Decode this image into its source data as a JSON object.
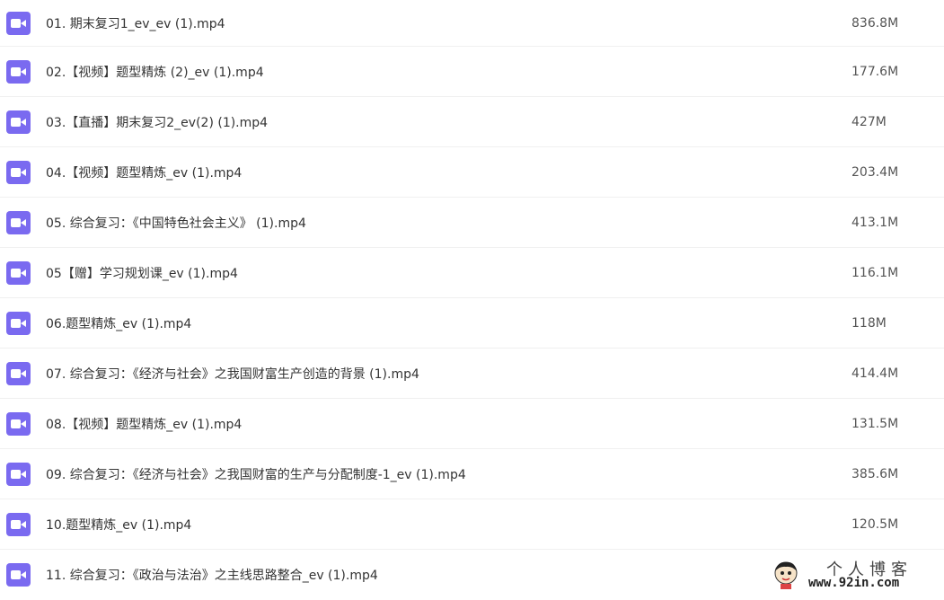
{
  "files": [
    {
      "name": "01. 期末复习1_ev_ev (1).mp4",
      "size": "836.8M",
      "icon": "video-file-icon"
    },
    {
      "name": "02.【视频】题型精炼 (2)_ev (1).mp4",
      "size": "177.6M",
      "icon": "video-file-icon"
    },
    {
      "name": "03.【直播】期末复习2_ev(2) (1).mp4",
      "size": "427M",
      "icon": "video-file-icon"
    },
    {
      "name": "04.【视频】题型精炼_ev (1).mp4",
      "size": "203.4M",
      "icon": "video-file-icon"
    },
    {
      "name": "05. 综合复习：《中国特色社会主义》 (1).mp4",
      "size": "413.1M",
      "icon": "video-file-icon"
    },
    {
      "name": "05【赠】学习规划课_ev (1).mp4",
      "size": "116.1M",
      "icon": "video-file-icon"
    },
    {
      "name": "06.题型精炼_ev (1).mp4",
      "size": "118M",
      "icon": "video-file-icon"
    },
    {
      "name": "07. 综合复习：《经济与社会》之我国财富生产创造的背景 (1).mp4",
      "size": "414.4M",
      "icon": "video-file-icon"
    },
    {
      "name": "08.【视频】题型精炼_ev (1).mp4",
      "size": "131.5M",
      "icon": "video-file-icon"
    },
    {
      "name": "09. 综合复习：《经济与社会》之我国财富的生产与分配制度-1_ev (1).mp4",
      "size": "385.6M",
      "icon": "video-file-icon"
    },
    {
      "name": "10.题型精炼_ev (1).mp4",
      "size": "120.5M",
      "icon": "video-file-icon"
    },
    {
      "name": "11. 综合复习：《政治与法治》之主线思路整合_ev (1).mp4",
      "size": "",
      "icon": "video-file-icon"
    }
  ],
  "watermark": {
    "title": "个人博客",
    "url": "www.92in.com"
  },
  "colors": {
    "icon_bg": "#7a6af0",
    "divider": "#f0f0f0",
    "text": "#333333"
  }
}
